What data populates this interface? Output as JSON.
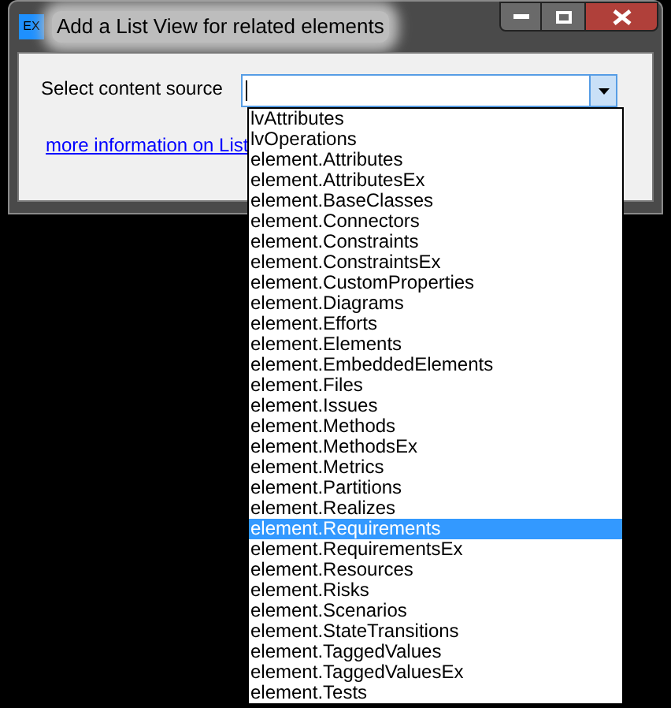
{
  "window": {
    "icon_text": "EX",
    "title": "Add a List View for related elements"
  },
  "form": {
    "label": "Select content source",
    "link": "more information on List"
  },
  "dropdown": {
    "items": [
      {
        "label": "lvAttributes",
        "selected": false
      },
      {
        "label": "lvOperations",
        "selected": false
      },
      {
        "label": "element.Attributes",
        "selected": false
      },
      {
        "label": "element.AttributesEx",
        "selected": false
      },
      {
        "label": "element.BaseClasses",
        "selected": false
      },
      {
        "label": "element.Connectors",
        "selected": false
      },
      {
        "label": "element.Constraints",
        "selected": false
      },
      {
        "label": "element.ConstraintsEx",
        "selected": false
      },
      {
        "label": "element.CustomProperties",
        "selected": false
      },
      {
        "label": "element.Diagrams",
        "selected": false
      },
      {
        "label": "element.Efforts",
        "selected": false
      },
      {
        "label": "element.Elements",
        "selected": false
      },
      {
        "label": "element.EmbeddedElements",
        "selected": false
      },
      {
        "label": "element.Files",
        "selected": false
      },
      {
        "label": "element.Issues",
        "selected": false
      },
      {
        "label": "element.Methods",
        "selected": false
      },
      {
        "label": "element.MethodsEx",
        "selected": false
      },
      {
        "label": "element.Metrics",
        "selected": false
      },
      {
        "label": "element.Partitions",
        "selected": false
      },
      {
        "label": "element.Realizes",
        "selected": false
      },
      {
        "label": "element.Requirements",
        "selected": true
      },
      {
        "label": "element.RequirementsEx",
        "selected": false
      },
      {
        "label": "element.Resources",
        "selected": false
      },
      {
        "label": "element.Risks",
        "selected": false
      },
      {
        "label": "element.Scenarios",
        "selected": false
      },
      {
        "label": "element.StateTransitions",
        "selected": false
      },
      {
        "label": "element.TaggedValues",
        "selected": false
      },
      {
        "label": "element.TaggedValuesEx",
        "selected": false
      },
      {
        "label": "element.Tests",
        "selected": false
      }
    ]
  }
}
